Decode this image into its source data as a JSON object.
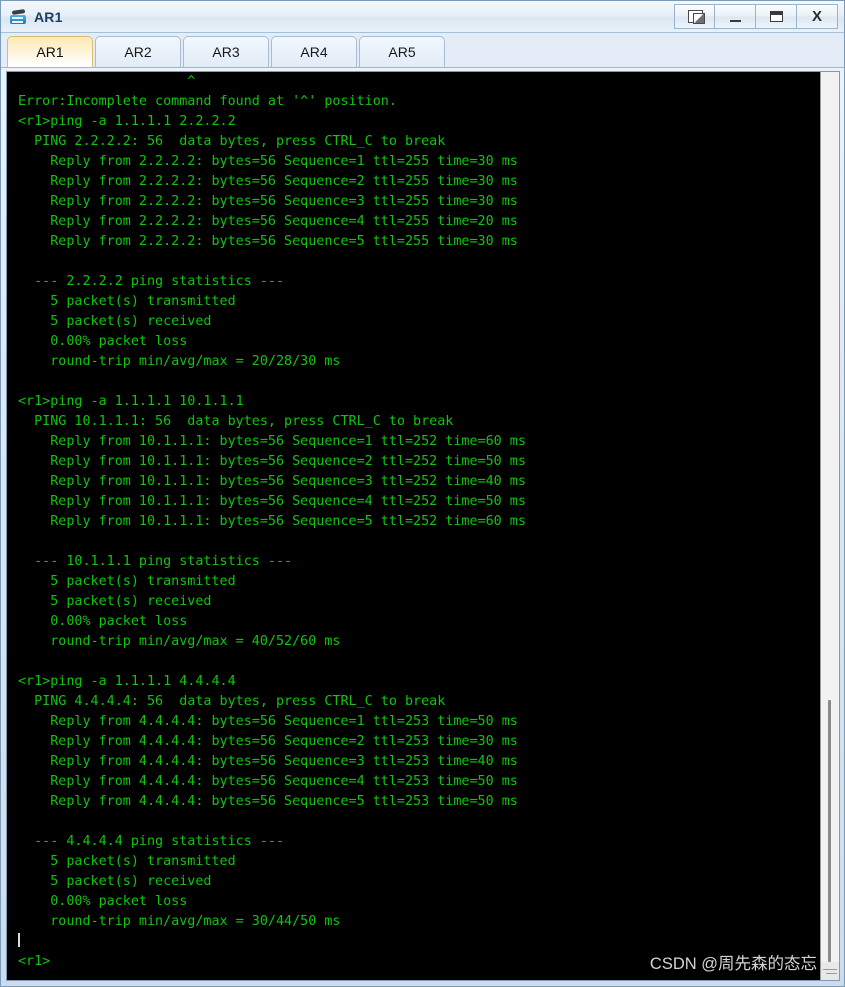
{
  "window": {
    "title": "AR1",
    "icon": "router-icon",
    "buttons": [
      {
        "name": "restore-windows-button",
        "label": ""
      },
      {
        "name": "minimize-button",
        "label": ""
      },
      {
        "name": "maximize-button",
        "label": ""
      },
      {
        "name": "close-button",
        "label": "X"
      }
    ]
  },
  "tabs": [
    {
      "label": "AR1",
      "active": true
    },
    {
      "label": "AR2",
      "active": false
    },
    {
      "label": "AR3",
      "active": false
    },
    {
      "label": "AR4",
      "active": false
    },
    {
      "label": "AR5",
      "active": false
    }
  ],
  "terminal": {
    "prompt": "<r1>",
    "foreground": "#10c410",
    "background": "#000000",
    "lines": [
      "                     ^",
      "Error:Incomplete command found at '^' position.",
      "<r1>ping -a 1.1.1.1 2.2.2.2",
      "  PING 2.2.2.2: 56  data bytes, press CTRL_C to break",
      "    Reply from 2.2.2.2: bytes=56 Sequence=1 ttl=255 time=30 ms",
      "    Reply from 2.2.2.2: bytes=56 Sequence=2 ttl=255 time=30 ms",
      "    Reply from 2.2.2.2: bytes=56 Sequence=3 ttl=255 time=30 ms",
      "    Reply from 2.2.2.2: bytes=56 Sequence=4 ttl=255 time=20 ms",
      "    Reply from 2.2.2.2: bytes=56 Sequence=5 ttl=255 time=30 ms",
      "",
      "  --- 2.2.2.2 ping statistics ---",
      "    5 packet(s) transmitted",
      "    5 packet(s) received",
      "    0.00% packet loss",
      "    round-trip min/avg/max = 20/28/30 ms",
      "",
      "<r1>ping -a 1.1.1.1 10.1.1.1",
      "  PING 10.1.1.1: 56  data bytes, press CTRL_C to break",
      "    Reply from 10.1.1.1: bytes=56 Sequence=1 ttl=252 time=60 ms",
      "    Reply from 10.1.1.1: bytes=56 Sequence=2 ttl=252 time=50 ms",
      "    Reply from 10.1.1.1: bytes=56 Sequence=3 ttl=252 time=40 ms",
      "    Reply from 10.1.1.1: bytes=56 Sequence=4 ttl=252 time=50 ms",
      "    Reply from 10.1.1.1: bytes=56 Sequence=5 ttl=252 time=60 ms",
      "",
      "  --- 10.1.1.1 ping statistics ---",
      "    5 packet(s) transmitted",
      "    5 packet(s) received",
      "    0.00% packet loss",
      "    round-trip min/avg/max = 40/52/60 ms",
      "",
      "<r1>ping -a 1.1.1.1 4.4.4.4",
      "  PING 4.4.4.4: 56  data bytes, press CTRL_C to break",
      "    Reply from 4.4.4.4: bytes=56 Sequence=1 ttl=253 time=50 ms",
      "    Reply from 4.4.4.4: bytes=56 Sequence=2 ttl=253 time=30 ms",
      "    Reply from 4.4.4.4: bytes=56 Sequence=3 ttl=253 time=40 ms",
      "    Reply from 4.4.4.4: bytes=56 Sequence=4 ttl=253 time=50 ms",
      "    Reply from 4.4.4.4: bytes=56 Sequence=5 ttl=253 time=50 ms",
      "",
      "  --- 4.4.4.4 ping statistics ---",
      "    5 packet(s) transmitted",
      "    5 packet(s) received",
      "    0.00% packet loss",
      "    round-trip min/avg/max = 30/44/50 ms",
      "",
      "<r1>"
    ],
    "cursor_line_index": 43
  },
  "watermark": {
    "text": "CSDN @周先森的态忘"
  }
}
